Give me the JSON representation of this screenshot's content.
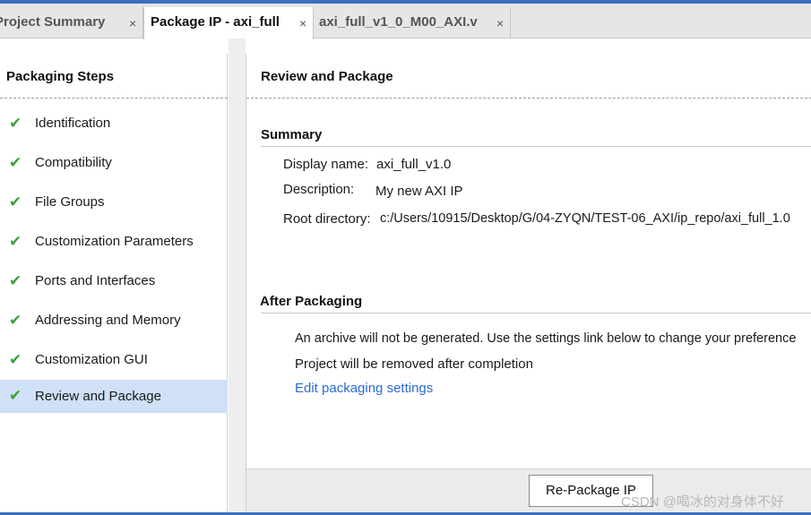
{
  "tabs": [
    {
      "label": "Project Summary",
      "close": "×"
    },
    {
      "label": "Package IP - axi_full",
      "close": "×",
      "active": true
    },
    {
      "label": "axi_full_v1_0_M00_AXI.v",
      "close": "×"
    }
  ],
  "sidebar": {
    "title": "Packaging Steps",
    "check_icon": "✔",
    "items": [
      {
        "label": "Identification"
      },
      {
        "label": "Compatibility"
      },
      {
        "label": "File Groups"
      },
      {
        "label": "Customization Parameters"
      },
      {
        "label": "Ports and Interfaces"
      },
      {
        "label": "Addressing and Memory"
      },
      {
        "label": "Customization GUI"
      },
      {
        "label": "Review and Package",
        "selected": true
      }
    ]
  },
  "main": {
    "title": "Review and Package",
    "summary": {
      "title": "Summary",
      "display_name_label": "Display name:",
      "display_name_value": "axi_full_v1.0",
      "description_label": "Description:",
      "description_value": "My new AXI IP",
      "root_dir_label": "Root directory:",
      "root_dir_value": "c:/Users/10915/Desktop/G/04-ZYQN/TEST-06_AXI/ip_repo/axi_full_1.0"
    },
    "after_packaging": {
      "title": "After Packaging",
      "line1": "An archive will not be generated. Use the settings link below to change your preference",
      "line2": "Project will be removed after completion",
      "link": "Edit packaging settings"
    },
    "button": "Re-Package IP"
  },
  "watermark": "CSDN @喝冰的对身体不好",
  "colors": {
    "accent": "#3d6fbf",
    "selected": "#cfe0f7",
    "check": "#3aa13a",
    "link": "#2a6ad4"
  }
}
